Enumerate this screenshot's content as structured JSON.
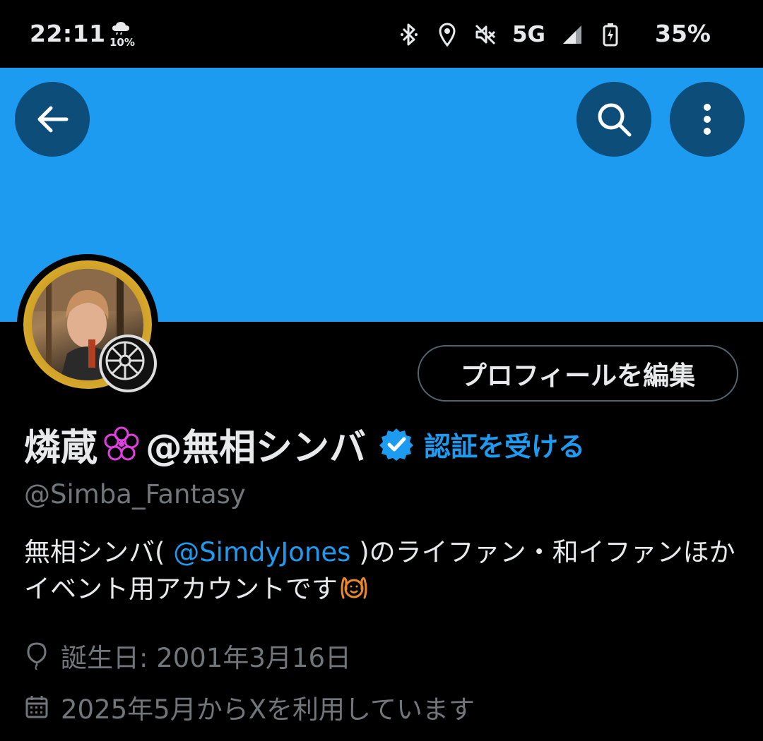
{
  "status_bar": {
    "time": "22:11",
    "weather_icon": "cloud-rain-icon",
    "weather_percent": "10%",
    "network": "5G",
    "battery": "35%"
  },
  "header": {
    "back_icon": "arrow-left-icon",
    "search_icon": "search-icon",
    "more_icon": "more-vertical-icon",
    "banner_color": "#1d9bf0"
  },
  "profile": {
    "edit_button_label": "プロフィールを編集",
    "name_part1": "燐蔵",
    "name_part2": "@無相シンバ",
    "get_verified_label": "認証を受ける",
    "handle": "@Simba_Fantasy",
    "bio": {
      "before": "無相シンバ(",
      "mention": " @SimdyJones ",
      "after": ")のライファン・和イファンほかイベント用アカウントです"
    },
    "birthday": "誕生日: 2001年3月16日",
    "joined": "2025年5月からXを利用しています"
  },
  "colors": {
    "accent": "#1d9bf0",
    "muted": "#71767b",
    "text": "#e7e9ea",
    "background": "#000000"
  }
}
